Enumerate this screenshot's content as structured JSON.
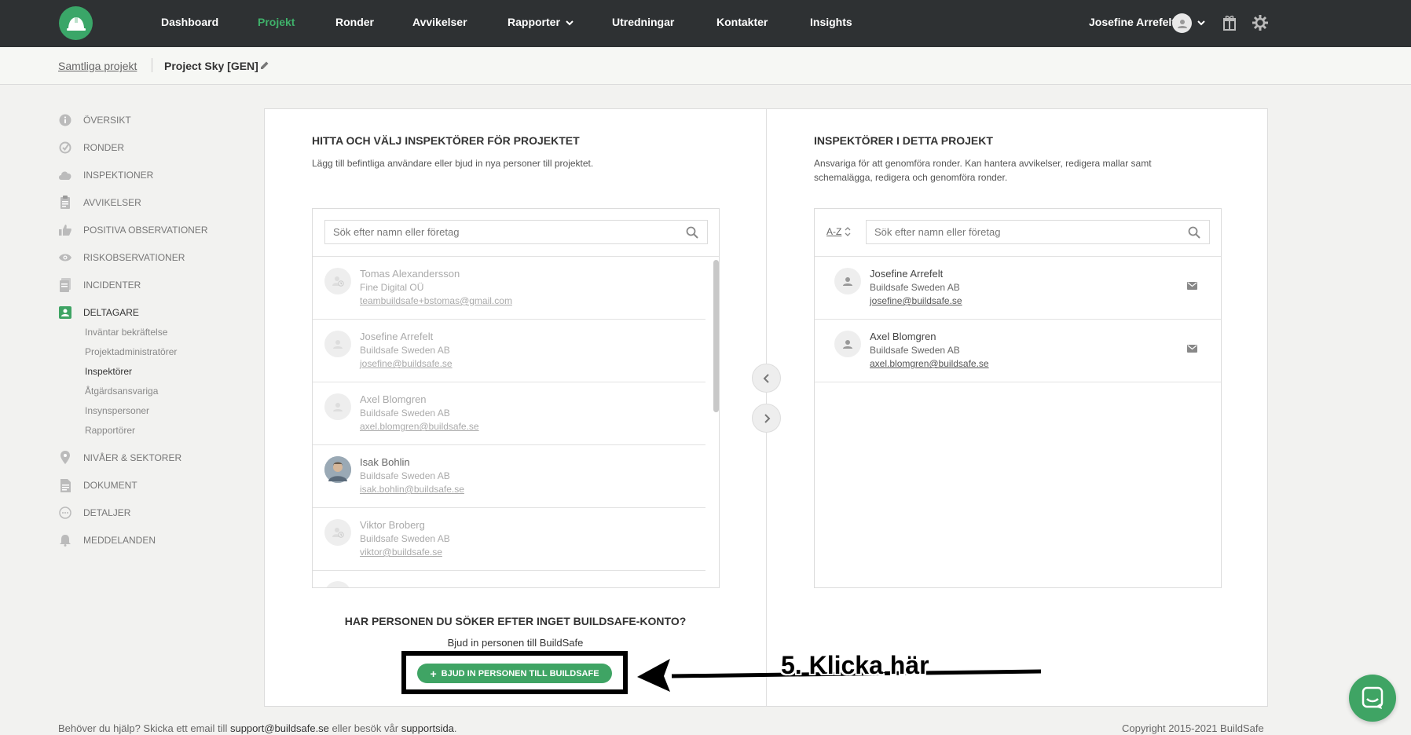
{
  "colors": {
    "accent": "#3fa464",
    "nav_bg": "#2e3133",
    "active_nav": "#3fb06a"
  },
  "nav": {
    "items": [
      {
        "label": "Dashboard"
      },
      {
        "label": "Projekt"
      },
      {
        "label": "Ronder"
      },
      {
        "label": "Avvikelser"
      },
      {
        "label": "Rapporter"
      },
      {
        "label": "Utredningar"
      },
      {
        "label": "Kontakter"
      },
      {
        "label": "Insights"
      }
    ],
    "active": "Projekt",
    "user_name": "Josefine Arrefelt",
    "icons": [
      "helmet-logo-icon",
      "user-avatar-icon",
      "chevron-down-icon",
      "gift-icon",
      "settings-icon"
    ]
  },
  "breadcrumb": {
    "all_projects": "Samtliga projekt",
    "current": "Project Sky [GEN]"
  },
  "sidebar": {
    "items": [
      {
        "label": "Översikt",
        "icon": "info-icon"
      },
      {
        "label": "Ronder",
        "icon": "check-circle-icon"
      },
      {
        "label": "Inspektioner",
        "icon": "cloud-icon"
      },
      {
        "label": "Avvikelser",
        "icon": "clipboard-icon"
      },
      {
        "label": "Positiva observationer",
        "icon": "thumbs-up-icon"
      },
      {
        "label": "Riskobservationer",
        "icon": "eye-icon"
      },
      {
        "label": "Incidenter",
        "icon": "document-icon"
      },
      {
        "label": "Deltagare",
        "icon": "person-card-icon"
      },
      {
        "label": "Nivåer & sektorer",
        "icon": "location-pin-icon"
      },
      {
        "label": "Dokument",
        "icon": "file-icon"
      },
      {
        "label": "Detaljer",
        "icon": "more-circle-icon"
      },
      {
        "label": "Meddelanden",
        "icon": "bell-icon"
      }
    ],
    "active": "Deltagare",
    "sub_items": [
      {
        "label": "Inväntar bekräftelse"
      },
      {
        "label": "Projektadministratörer"
      },
      {
        "label": "Inspektörer"
      },
      {
        "label": "Åtgärdsansvariga"
      },
      {
        "label": "Insynspersoner"
      },
      {
        "label": "Rapportörer"
      }
    ],
    "active_sub": "Inspektörer"
  },
  "left": {
    "title": "Hitta och välj inspektörer för projektet",
    "desc": "Lägg till befintliga användare eller bjud in nya personer till projektet.",
    "search_placeholder": "Sök efter namn eller företag",
    "people": [
      {
        "name": "Tomas Alexandersson",
        "company": "Fine Digital OÜ",
        "email": "teambuildsafe+bstomas@gmail.com",
        "state": "pending"
      },
      {
        "name": "Josefine Arrefelt",
        "company": "Buildsafe Sweden AB",
        "email": "josefine@buildsafe.se",
        "state": "selected"
      },
      {
        "name": "Axel Blomgren",
        "company": "Buildsafe Sweden AB",
        "email": "axel.blomgren@buildsafe.se",
        "state": "selected"
      },
      {
        "name": "Isak Bohlin",
        "company": "Buildsafe Sweden AB",
        "email": "isak.bohlin@buildsafe.se",
        "state": "photo"
      },
      {
        "name": "Viktor Broberg",
        "company": "Buildsafe Sweden AB",
        "email": "viktor@buildsafe.se",
        "state": "pending"
      }
    ]
  },
  "right": {
    "title": "Inspektörer i detta projekt",
    "desc": "Ansvariga för att genomföra ronder. Kan hantera avvikelser, redigera mallar samt schemalägga, redigera och genomföra ronder.",
    "sort_label": "A-Z",
    "search_placeholder": "Sök efter namn eller företag",
    "people": [
      {
        "name": "Josefine Arrefelt",
        "company": "Buildsafe Sweden AB",
        "email": "josefine@buildsafe.se"
      },
      {
        "name": "Axel Blomgren",
        "company": "Buildsafe Sweden AB",
        "email": "axel.blomgren@buildsafe.se"
      }
    ]
  },
  "invite": {
    "title": "Har personen du söker efter inget BuildSafe-konto?",
    "subtitle": "Bjud in personen till BuildSafe",
    "button": "Bjud in personen till BuildSafe"
  },
  "annotation": "5. Klicka här",
  "footer": {
    "help_prefix": "Behöver du hjälp? Skicka ett email till",
    "help_email": "support@buildsafe.se",
    "help_mid": "eller besök vår",
    "help_link": "supportsida",
    "help_suffix": ".",
    "copyright": "Copyright 2015-2021 BuildSafe"
  }
}
